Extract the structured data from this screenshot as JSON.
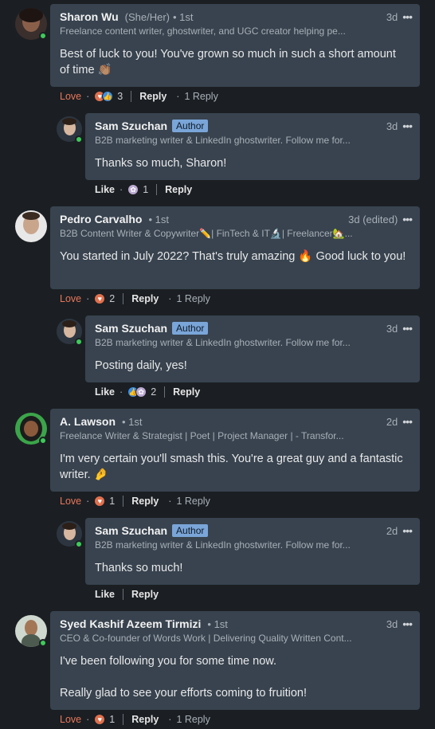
{
  "colors": {
    "background": "#1b1f23",
    "bubble": "#38434f",
    "love": "#e8765a",
    "author_badge": "#7aa5d8",
    "online": "#3ecb5a"
  },
  "comments": [
    {
      "name": "Sharon Wu",
      "pronouns": "(She/Her)",
      "degree": "• 1st",
      "time": "3d",
      "headline": "Freelance content writer, ghostwriter, and UGC creator helping pe...",
      "text": "Best of luck to you! You've grown so much in such a short amount of time 👏🏽",
      "reaction_label": "Love",
      "reaction_icons": [
        "heart-icon",
        "thumb-icon"
      ],
      "reaction_count": "3",
      "reply_label": "Reply",
      "replies_label": "1 Reply",
      "reply": {
        "name": "Sam Szuchan",
        "badge": "Author",
        "time": "3d",
        "headline": "B2B marketing writer & LinkedIn ghostwriter. Follow me for...",
        "text": "Thanks so much, Sharon!",
        "reaction_label": "Like",
        "reaction_icons": [
          "support-icon"
        ],
        "reaction_count": "1",
        "reply_label": "Reply"
      }
    },
    {
      "name": "Pedro Carvalho",
      "degree": "• 1st",
      "time": "3d (edited)",
      "headline": "B2B Content Writer & Copywriter✏️| FinTech & IT🔬| Freelancer🏡...",
      "text": "You started in July 2022? That's truly amazing 🔥 Good luck to you!",
      "reaction_label": "Love",
      "reaction_icons": [
        "heart-icon"
      ],
      "reaction_count": "2",
      "reply_label": "Reply",
      "replies_label": "1 Reply",
      "reply": {
        "name": "Sam Szuchan",
        "badge": "Author",
        "time": "3d",
        "headline": "B2B marketing writer & LinkedIn ghostwriter. Follow me for...",
        "text": "Posting daily, yes!",
        "reaction_label": "Like",
        "reaction_icons": [
          "thumb-icon",
          "support-icon"
        ],
        "reaction_count": "2",
        "reply_label": "Reply"
      }
    },
    {
      "name": "A. Lawson",
      "degree": "• 1st",
      "time": "2d",
      "headline": "Freelance Writer & Strategist | Poet | Project Manager | - Transfor...",
      "text": "I'm very certain you'll smash this. You're a great guy and a fantastic writer. 🤌",
      "reaction_label": "Love",
      "reaction_icons": [
        "heart-icon"
      ],
      "reaction_count": "1",
      "reply_label": "Reply",
      "replies_label": "1 Reply",
      "reply": {
        "name": "Sam Szuchan",
        "badge": "Author",
        "time": "2d",
        "headline": "B2B marketing writer & LinkedIn ghostwriter. Follow me for...",
        "text": "Thanks so much!",
        "reaction_label": "Like",
        "reply_label": "Reply"
      }
    },
    {
      "name": "Syed Kashif Azeem Tirmizi",
      "degree": "• 1st",
      "time": "3d",
      "headline": "CEO & Co-founder of Words Work | Delivering Quality Written Cont...",
      "text": "I've been following you for some time now.\n\nReally glad to see your efforts coming to fruition!",
      "reaction_label": "Love",
      "reaction_icons": [
        "heart-icon"
      ],
      "reaction_count": "1",
      "reply_label": "Reply",
      "replies_label": "1 Reply"
    }
  ]
}
